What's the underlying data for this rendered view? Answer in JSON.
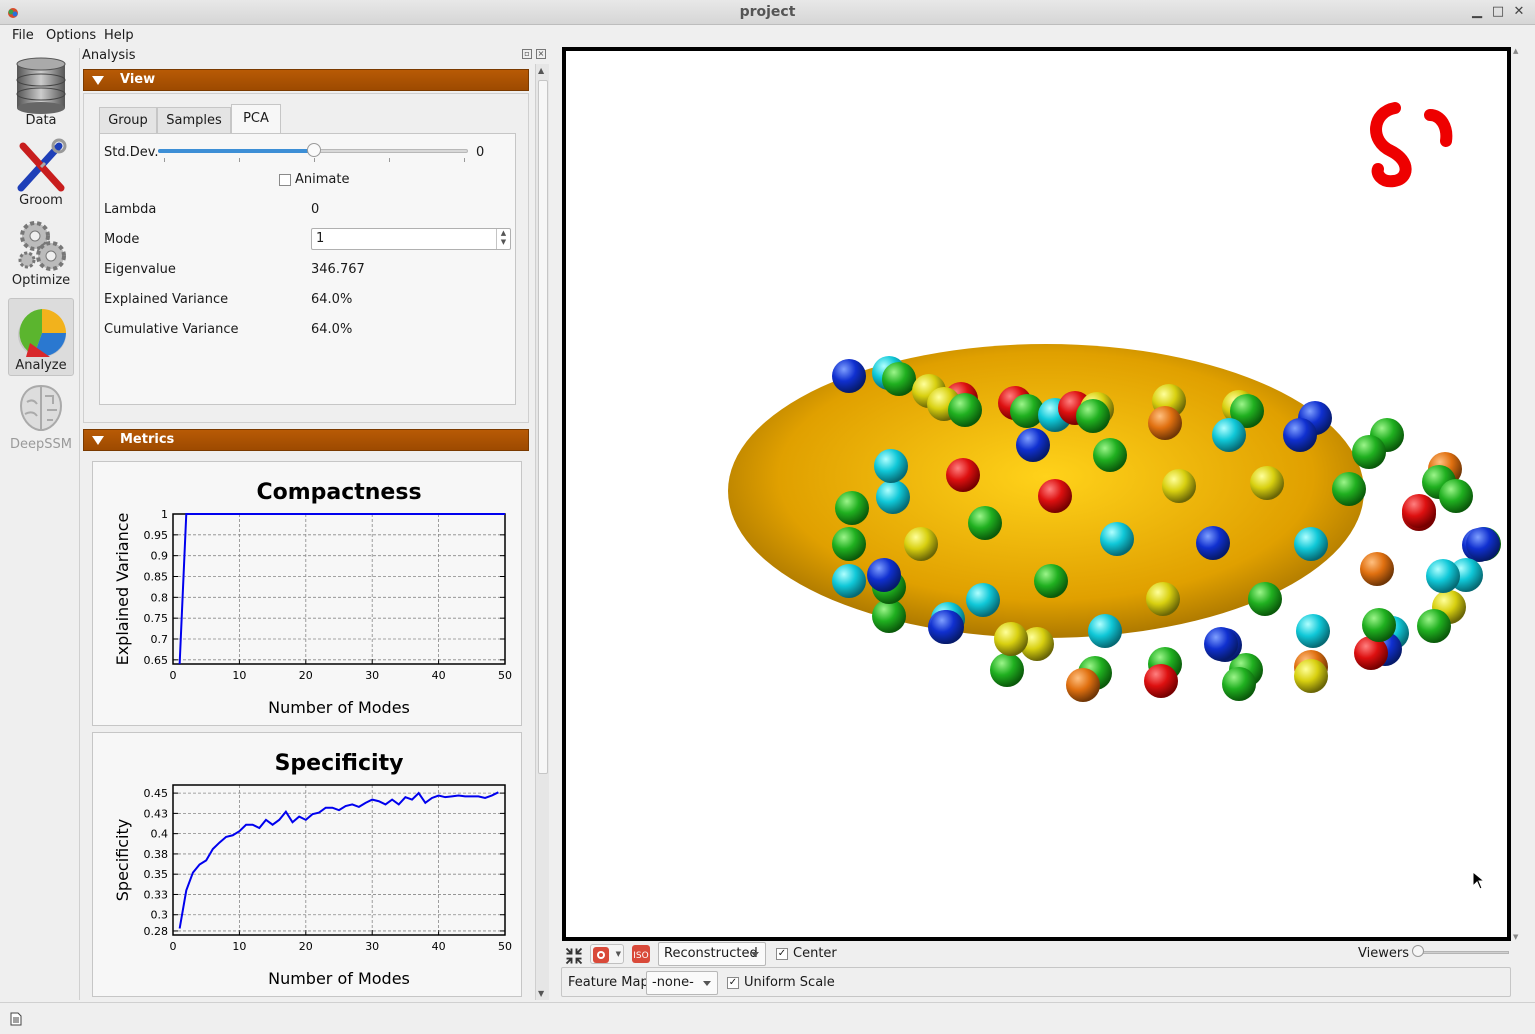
{
  "window": {
    "title": "project"
  },
  "menu": [
    "File",
    "Options",
    "Help"
  ],
  "toolbar": [
    {
      "label": "Data",
      "icon": "database-icon"
    },
    {
      "label": "Groom",
      "icon": "groom-tools-icon"
    },
    {
      "label": "Optimize",
      "icon": "gears-icon"
    },
    {
      "label": "Analyze",
      "icon": "pie-chart-icon",
      "active": true
    },
    {
      "label": "DeepSSM",
      "icon": "brain-icon",
      "disabled": true
    }
  ],
  "dock": {
    "title": "Analysis"
  },
  "view_section": {
    "header": "View",
    "tabs": [
      "Group",
      "Samples",
      "PCA"
    ],
    "active_tab": "PCA",
    "stddev": {
      "label": "Std.Dev.",
      "value": "0",
      "position": 0.5
    },
    "animate": {
      "label": "Animate",
      "checked": false
    },
    "lambda": {
      "label": "Lambda",
      "value": "0"
    },
    "mode": {
      "label": "Mode",
      "value": "1"
    },
    "eigenvalue": {
      "label": "Eigenvalue",
      "value": "346.767"
    },
    "explained_variance": {
      "label": "Explained Variance",
      "value": "64.0%"
    },
    "cumulative_variance": {
      "label": "Cumulative Variance",
      "value": "64.0%"
    }
  },
  "metrics_section": {
    "header": "Metrics"
  },
  "chart_data": [
    {
      "type": "line",
      "title": "Compactness",
      "xlabel": "Number of Modes",
      "ylabel": "Explained Variance",
      "xlim": [
        0,
        50
      ],
      "ylim": [
        0.64,
        1.0
      ],
      "xticks": [
        "0",
        "10",
        "20",
        "30",
        "40",
        "50"
      ],
      "yticks": [
        "0.65",
        "0.7",
        "0.75",
        "0.8",
        "0.85",
        "0.9",
        "0.95",
        "1"
      ],
      "grid": true,
      "color": "#0000ee",
      "x": [
        1,
        2,
        3,
        5,
        10,
        20,
        30,
        40,
        50
      ],
      "y": [
        0.64,
        1.0,
        1.0,
        1.0,
        1.0,
        1.0,
        1.0,
        1.0,
        1.0
      ]
    },
    {
      "type": "line",
      "title": "Specificity",
      "xlabel": "Number of Modes",
      "ylabel": "Specificity",
      "xlim": [
        0,
        50
      ],
      "ylim": [
        0.275,
        0.46
      ],
      "xticks": [
        "0",
        "10",
        "20",
        "30",
        "40",
        "50"
      ],
      "yticks": [
        "0.28",
        "0.3",
        "0.33",
        "0.35",
        "0.38",
        "0.4",
        "0.43",
        "0.45"
      ],
      "ytick_values": [
        0.28,
        0.3,
        0.325,
        0.35,
        0.375,
        0.4,
        0.425,
        0.45
      ],
      "grid": true,
      "color": "#0000ee",
      "x": [
        1,
        2,
        3,
        4,
        5,
        6,
        7,
        8,
        9,
        10,
        11,
        12,
        13,
        14,
        15,
        16,
        17,
        18,
        19,
        20,
        21,
        22,
        23,
        24,
        25,
        26,
        27,
        28,
        29,
        30,
        31,
        32,
        33,
        34,
        35,
        36,
        37,
        38,
        39,
        40,
        41,
        42,
        43,
        44,
        45,
        46,
        47,
        48,
        49
      ],
      "y": [
        0.283,
        0.33,
        0.352,
        0.362,
        0.367,
        0.381,
        0.389,
        0.396,
        0.398,
        0.403,
        0.411,
        0.411,
        0.407,
        0.417,
        0.411,
        0.417,
        0.427,
        0.414,
        0.421,
        0.417,
        0.424,
        0.426,
        0.432,
        0.432,
        0.429,
        0.434,
        0.436,
        0.433,
        0.438,
        0.442,
        0.44,
        0.436,
        0.442,
        0.436,
        0.445,
        0.442,
        0.45,
        0.438,
        0.444,
        0.447,
        0.445,
        0.446,
        0.447,
        0.446,
        0.446,
        0.446,
        0.444,
        0.447,
        0.451
      ]
    }
  ],
  "viewer_controls": {
    "display_mode": "Reconstructed",
    "center": {
      "label": "Center",
      "checked": true
    },
    "viewers_label": "Viewers",
    "feature_map": {
      "label": "Feature Map",
      "value": "-none-"
    },
    "uniform_scale": {
      "label": "Uniform Scale",
      "checked": true
    }
  },
  "colors": {
    "section_header": "#a84f00",
    "shape": "#e8a800",
    "logo": "#ee0000",
    "accent": "#3d8fd6"
  }
}
